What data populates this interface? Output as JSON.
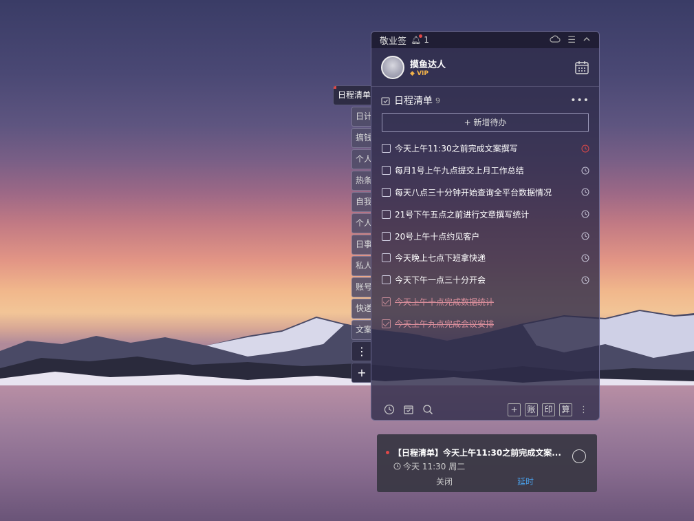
{
  "colors": {
    "accent": "#4a9fe8",
    "alert": "#e04848",
    "vip": "#f2b24a",
    "done_text": "#d78d9a"
  },
  "titlebar": {
    "app_name": "敬业签",
    "notify_count": "1"
  },
  "user": {
    "name": "摸鱼达人",
    "vip_label": "VIP"
  },
  "main_tab": {
    "label": "日程清单"
  },
  "side_tabs": [
    "日计",
    "搞钱",
    "个人",
    "热条",
    "自我",
    "个人",
    "日事",
    "私人",
    "账号",
    "快递",
    "文案"
  ],
  "list": {
    "title": "日程清单",
    "count": "9",
    "add_label": "+ 新增待办",
    "items": [
      {
        "text": "今天上午11:30之前完成文案撰写",
        "done": false,
        "alert": true
      },
      {
        "text": "每月1号上午九点提交上月工作总结",
        "done": false,
        "alert": false
      },
      {
        "text": "每天八点三十分钟开始查询全平台数据情况",
        "done": false,
        "alert": false
      },
      {
        "text": "21号下午五点之前进行文章撰写统计",
        "done": false,
        "alert": false
      },
      {
        "text": "20号上午十点约见客户",
        "done": false,
        "alert": false
      },
      {
        "text": "今天晚上七点下班拿快递",
        "done": false,
        "alert": false
      },
      {
        "text": "今天下午一点三十分开会",
        "done": false,
        "alert": false
      },
      {
        "text": "今天上午十点完成数据统计",
        "done": true,
        "alert": false
      },
      {
        "text": "今天上午九点完成会议安排",
        "done": true,
        "alert": false
      }
    ]
  },
  "bottombar": {
    "btn_account": "账",
    "btn_print": "印",
    "btn_calc": "算"
  },
  "notification": {
    "title": "【日程清单】今天上午11:30之前完成文案...",
    "time": "今天 11:30 周二",
    "close_label": "关闭",
    "delay_label": "延时"
  }
}
